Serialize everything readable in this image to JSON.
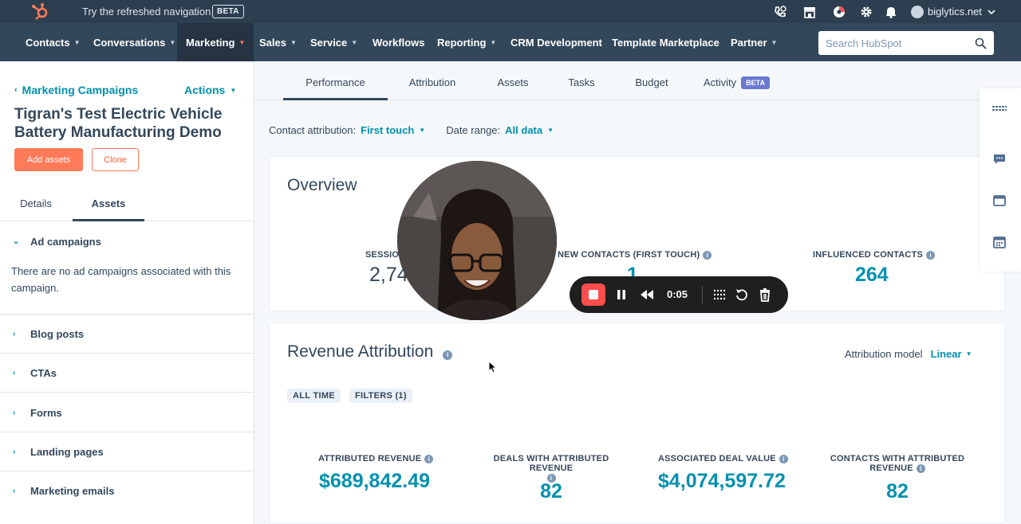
{
  "topbar": {
    "try_nav": "Try the refreshed navigation",
    "beta": "BETA",
    "account": "biglytics.net"
  },
  "nav": {
    "items": [
      {
        "label": "Contacts",
        "dropdown": true
      },
      {
        "label": "Conversations",
        "dropdown": true
      },
      {
        "label": "Marketing",
        "dropdown": true,
        "active": true
      },
      {
        "label": "Sales",
        "dropdown": true
      },
      {
        "label": "Service",
        "dropdown": true
      },
      {
        "label": "Workflows",
        "dropdown": false
      },
      {
        "label": "Reporting",
        "dropdown": true
      },
      {
        "label": "CRM Development",
        "dropdown": false
      },
      {
        "label": "Template Marketplace",
        "dropdown": false
      },
      {
        "label": "Partner",
        "dropdown": true
      }
    ],
    "search_placeholder": "Search HubSpot"
  },
  "sidebar": {
    "back_label": "Marketing Campaigns",
    "actions_label": "Actions",
    "campaign_title": "Tigran's Test Electric Vehicle Battery Manufacturing Demo",
    "add_assets": "Add assets",
    "clone": "Clone",
    "tabs": [
      "Details",
      "Assets"
    ],
    "active_tab": "Assets",
    "sections": [
      {
        "label": "Ad campaigns",
        "expanded": true,
        "text": "There are no ad campaigns associated with this campaign."
      },
      {
        "label": "Blog posts",
        "expanded": false
      },
      {
        "label": "CTAs",
        "expanded": false
      },
      {
        "label": "Forms",
        "expanded": false
      },
      {
        "label": "Landing pages",
        "expanded": false
      },
      {
        "label": "Marketing emails",
        "expanded": false
      }
    ]
  },
  "main": {
    "tabs": [
      "Performance",
      "Attribution",
      "Assets",
      "Tasks",
      "Budget",
      "Activity"
    ],
    "active_tab": "Performance",
    "activity_badge": "BETA",
    "filters": {
      "contact_attribution_label": "Contact attribution:",
      "contact_attribution_value": "First touch",
      "date_range_label": "Date range:",
      "date_range_value": "All data"
    },
    "overview": {
      "title": "Overview",
      "stats": [
        {
          "label": "SESSIO",
          "value": "2,74"
        },
        {
          "label": "NEW CONTACTS (FIRST TOUCH)",
          "value": "1"
        },
        {
          "label": "INFLUENCED CONTACTS",
          "value": "264"
        }
      ]
    },
    "revenue": {
      "title": "Revenue Attribution",
      "attribution_model_label": "Attribution model",
      "attribution_model_value": "Linear",
      "pills": [
        "ALL TIME",
        "FILTERS (1)"
      ],
      "stats": [
        {
          "label": "ATTRIBUTED REVENUE",
          "value": "$689,842.49"
        },
        {
          "label": "DEALS WITH ATTRIBUTED REVENUE",
          "value": "82"
        },
        {
          "label": "ASSOCIATED DEAL VALUE",
          "value": "$4,074,597.72"
        },
        {
          "label_line1": "CONTACTS WITH ATTRIBUTED",
          "label_line2": "REVENUE",
          "value": "82"
        }
      ]
    }
  },
  "recorder": {
    "time": "0:05"
  },
  "colors": {
    "accent": "#0091ae",
    "primary_button": "#ff7a59",
    "nav_bg": "#33475b",
    "topbar_bg": "#2d3e50"
  },
  "icons": [
    "hubspot-logo-icon",
    "calling-icon",
    "marketplace-icon",
    "help-icon",
    "gear-icon",
    "bell-icon",
    "search-icon",
    "grid-icon",
    "chat-icon",
    "window-icon",
    "calendar-icon"
  ]
}
